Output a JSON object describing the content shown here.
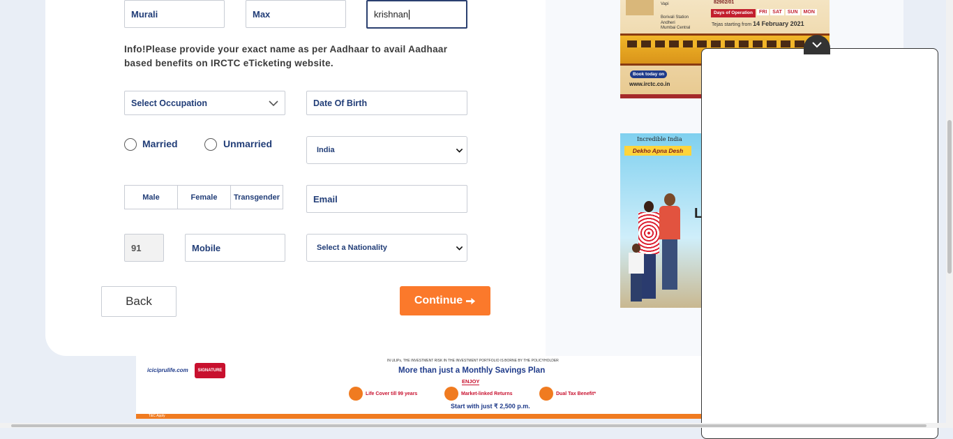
{
  "form": {
    "first_name": "Murali",
    "middle_name": "Max",
    "last_name": "krishnan",
    "info": "Info!Please provide your exact name as per Aadhaar to avail Aadhaar based benefits on IRCTC eTicketing website.",
    "occupation_placeholder": "Select Occupation",
    "dob_placeholder": "Date Of Birth",
    "marital": {
      "married": "Married",
      "unmarried": "Unmarried"
    },
    "country": "India",
    "gender": [
      "Male",
      "Female",
      "Transgender"
    ],
    "email_placeholder": "Email",
    "country_code": "91",
    "mobile_placeholder": "Mobile",
    "nationality_placeholder": "Select a Nationality"
  },
  "actions": {
    "back": "Back",
    "continue": "Continue"
  },
  "ads": {
    "tejas": {
      "code": "82902/01",
      "stations": [
        "Vapi",
        "Borivali Station",
        "Andheri",
        "Mumbai Central"
      ],
      "days_label": "Days of Operation",
      "days": [
        "FRI",
        "SAT",
        "SUN",
        "MON"
      ],
      "start_text": "Tejas starting from",
      "start_date": "14 February 2021",
      "book": "Book today on",
      "url": "www.irctc.co.in"
    },
    "incredible_india": {
      "brand": "Incredible India",
      "tagline": "Dekho Apna Desh",
      "cut_letter": "L"
    },
    "icici": {
      "domain": "iciciprulife.com",
      "badge": "SIGNATURE",
      "disclaimer": "IN ULIPs, THE INVESTMENT RISK IN THE INVESTMENT PORTFOLIO IS BORNE BY THE POLICYHOLDER",
      "headline": "More than just a Monthly Savings Plan",
      "enjoy": "ENJOY",
      "benefits": [
        "Life Cover till 99 years",
        "Market-linked Returns",
        "Dual Tax Benefit*"
      ],
      "price": "Start with just ₹ 2,500 p.m.",
      "tc": "T&C Apply"
    }
  },
  "colors": {
    "accent": "#fb792b",
    "text": "#213d77",
    "background": "#e9eef6"
  }
}
